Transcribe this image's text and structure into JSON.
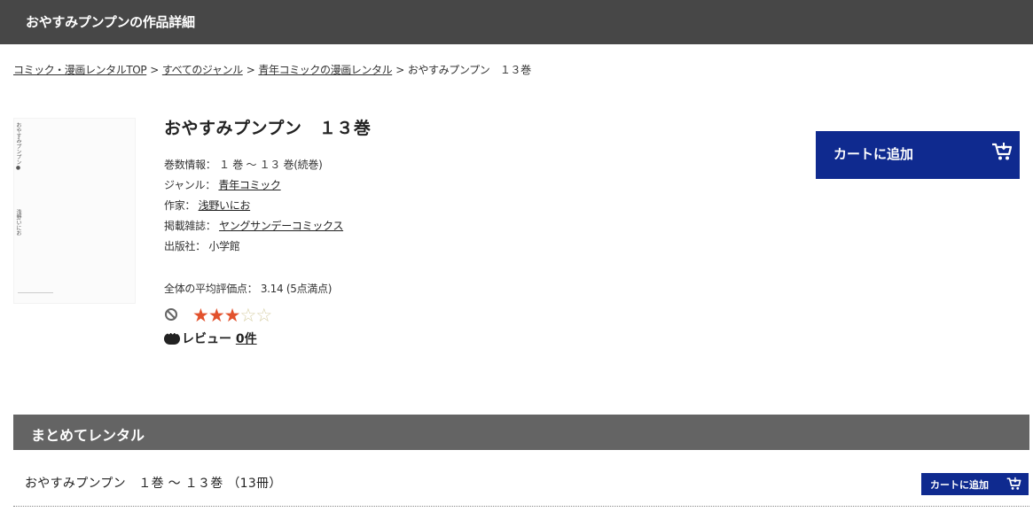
{
  "header": {
    "title": "おやすみプンプンの作品詳細"
  },
  "breadcrumb": {
    "items": [
      "コミック・漫画レンタルTOP",
      "すべてのジャンル",
      "青年コミックの漫画レンタル"
    ],
    "current": "おやすみプンプン　１３巻",
    "separator": ">"
  },
  "cover": {
    "title_vertical": "おやすみプンプン●",
    "author_vertical": "浅野いにお"
  },
  "work": {
    "title": "おやすみプンプン　１３巻",
    "volume_label": "巻数情報：",
    "volume_value": "１ 巻 ～ １３ 巻(続巻)",
    "genre_label": "ジャンル：",
    "genre_value": "青年コミック",
    "author_label": "作家：",
    "author_value": "浅野いにお",
    "magazine_label": "掲載雑誌：",
    "magazine_value": "ヤングサンデーコミックス",
    "publisher_label": "出版社：",
    "publisher_value": "小学館"
  },
  "rating": {
    "label": "全体の平均評価点：",
    "value": "3.14",
    "scale_note": "(5点満点)",
    "stars_filled": 3,
    "stars_total": 5
  },
  "review": {
    "label": "レビュー",
    "count": "0件"
  },
  "cart": {
    "add_label": "カートに追加"
  },
  "bundle": {
    "section_title": "まとめてレンタル",
    "item_text": "おやすみプンプン　１巻 ～ １３巻 （13冊）",
    "add_label": "カートに追加"
  },
  "colors": {
    "header_bg": "#474747",
    "cart_button": "#0f2a8f",
    "section_bg": "#646464",
    "star_filled": "#e2512c"
  },
  "icons": [
    "ban-icon",
    "star-icon",
    "comment-icon",
    "cart-icon"
  ]
}
